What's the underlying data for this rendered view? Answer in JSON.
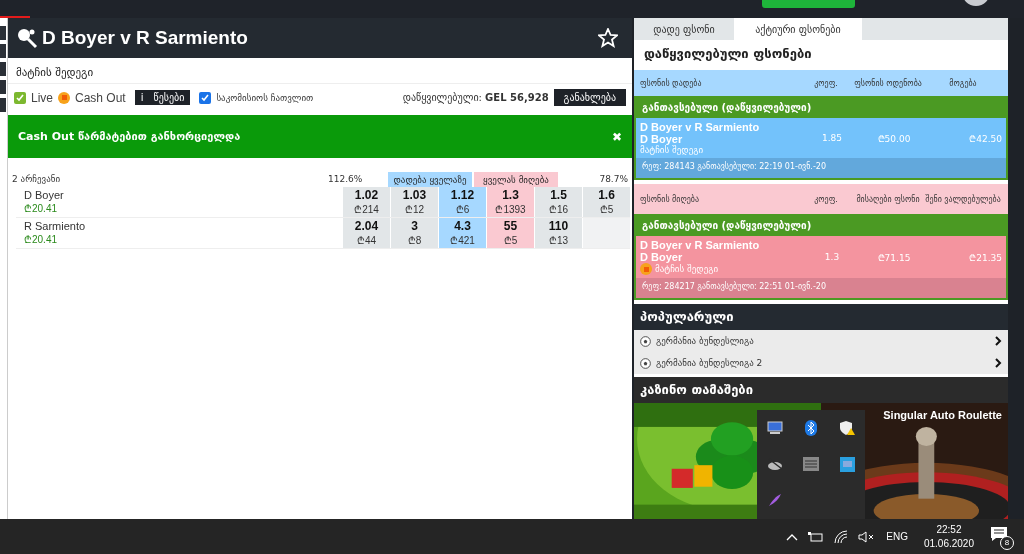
{
  "event": {
    "title": "D Boyer v R Sarmiento",
    "starred": false
  },
  "market": {
    "title": "მატჩის შედეგი"
  },
  "filters": {
    "live": {
      "label": "Live",
      "checked": true
    },
    "cashout": {
      "label": "Cash Out"
    },
    "rules_button": {
      "icon": "i",
      "label": "წესები"
    },
    "commission": {
      "label": "საკომისიოს ჩათვლით",
      "checked": true
    },
    "matched": "დაწყვილებული: **GEL 56,928**",
    "refresh_button": "განახლება"
  },
  "notice": {
    "text": "Cash Out წარმატებით განხორციელდა",
    "close": "✖"
  },
  "odds": {
    "selections": "2 არჩევანი",
    "back_overround": "112.6%",
    "back_all": "დადება ყველაზე",
    "lay_all": "ყველას მიღება",
    "lay_overround": "78.7%",
    "runners": [
      {
        "name": "D Boyer",
        "pl": "₾20.41",
        "prices": [
          {
            "kind": "back",
            "price": "1.02",
            "size": "₾214"
          },
          {
            "kind": "back",
            "price": "1.03",
            "size": "₾12"
          },
          {
            "kind": "back_best",
            "price": "1.12",
            "size": "₾6"
          },
          {
            "kind": "lay_best",
            "price": "1.3",
            "size": "₾1393"
          },
          {
            "kind": "lay",
            "price": "1.5",
            "size": "₾16"
          },
          {
            "kind": "lay",
            "price": "1.6",
            "size": "₾5"
          }
        ]
      },
      {
        "name": "R Sarmiento",
        "pl": "₾20.41",
        "prices": [
          {
            "kind": "back",
            "price": "2.04",
            "size": "₾44"
          },
          {
            "kind": "back",
            "price": "3",
            "size": "₾8"
          },
          {
            "kind": "back_best",
            "price": "4.3",
            "size": "₾421"
          },
          {
            "kind": "lay_best",
            "price": "55",
            "size": "₾5"
          },
          {
            "kind": "lay",
            "price": "110",
            "size": "₾13"
          }
        ]
      }
    ]
  },
  "betslip": {
    "tabs": [
      {
        "label": "დადე ფსონი",
        "selected": false
      },
      {
        "label": "აქტიური ფსონები",
        "selected": true
      }
    ],
    "title": "დაწყვილებული ფსონები",
    "sections": [
      {
        "kind": "back",
        "headers": [
          "ფსონის დადება",
          "კოეფ.",
          "ფსონის ოდენობა",
          "მოგება"
        ],
        "group": "განთავსებული (დაწყვილებული)",
        "bet": {
          "event": "D Boyer v R Sarmiento",
          "selection": "D Boyer",
          "market": "მატჩის შედეგი",
          "cashout": false,
          "odds": "1.85",
          "stake": "₾50.00",
          "result": "₾42.50",
          "ref": "რეფ: 284143 განთავსებული: 22:19 01-ივნ.-20"
        }
      },
      {
        "kind": "lay",
        "headers": [
          "ფსონის მიღება",
          "კოეფ.",
          "მისაღები ფსონი",
          "შენი ვალდებულება"
        ],
        "group": "განთავსებული (დაწყვილებული)",
        "bet": {
          "event": "D Boyer v R Sarmiento",
          "selection": "D Boyer",
          "market": "მატჩის შედეგი",
          "cashout": true,
          "odds": "1.3",
          "stake": "₾71.15",
          "result": "₾21.35",
          "ref": "რეფ: 284217 განთავსებული: 22:51 01-ივნ.-20"
        }
      }
    ]
  },
  "popular": {
    "title": "პოპულარული",
    "items": [
      {
        "label": "გერმანია ბუნდესლიგა"
      },
      {
        "label": "გერმანია ბუნდესლიგა 2"
      }
    ]
  },
  "casino": {
    "title": "კაზინო თამაშები",
    "games": [
      {
        "kind": "picture"
      },
      {
        "kind": "picture",
        "label": "Singular Auto Roulette"
      }
    ]
  },
  "taskbar": {
    "language": "ENG",
    "time": "22:52",
    "date": "01.06.2020",
    "notifications": "8"
  }
}
